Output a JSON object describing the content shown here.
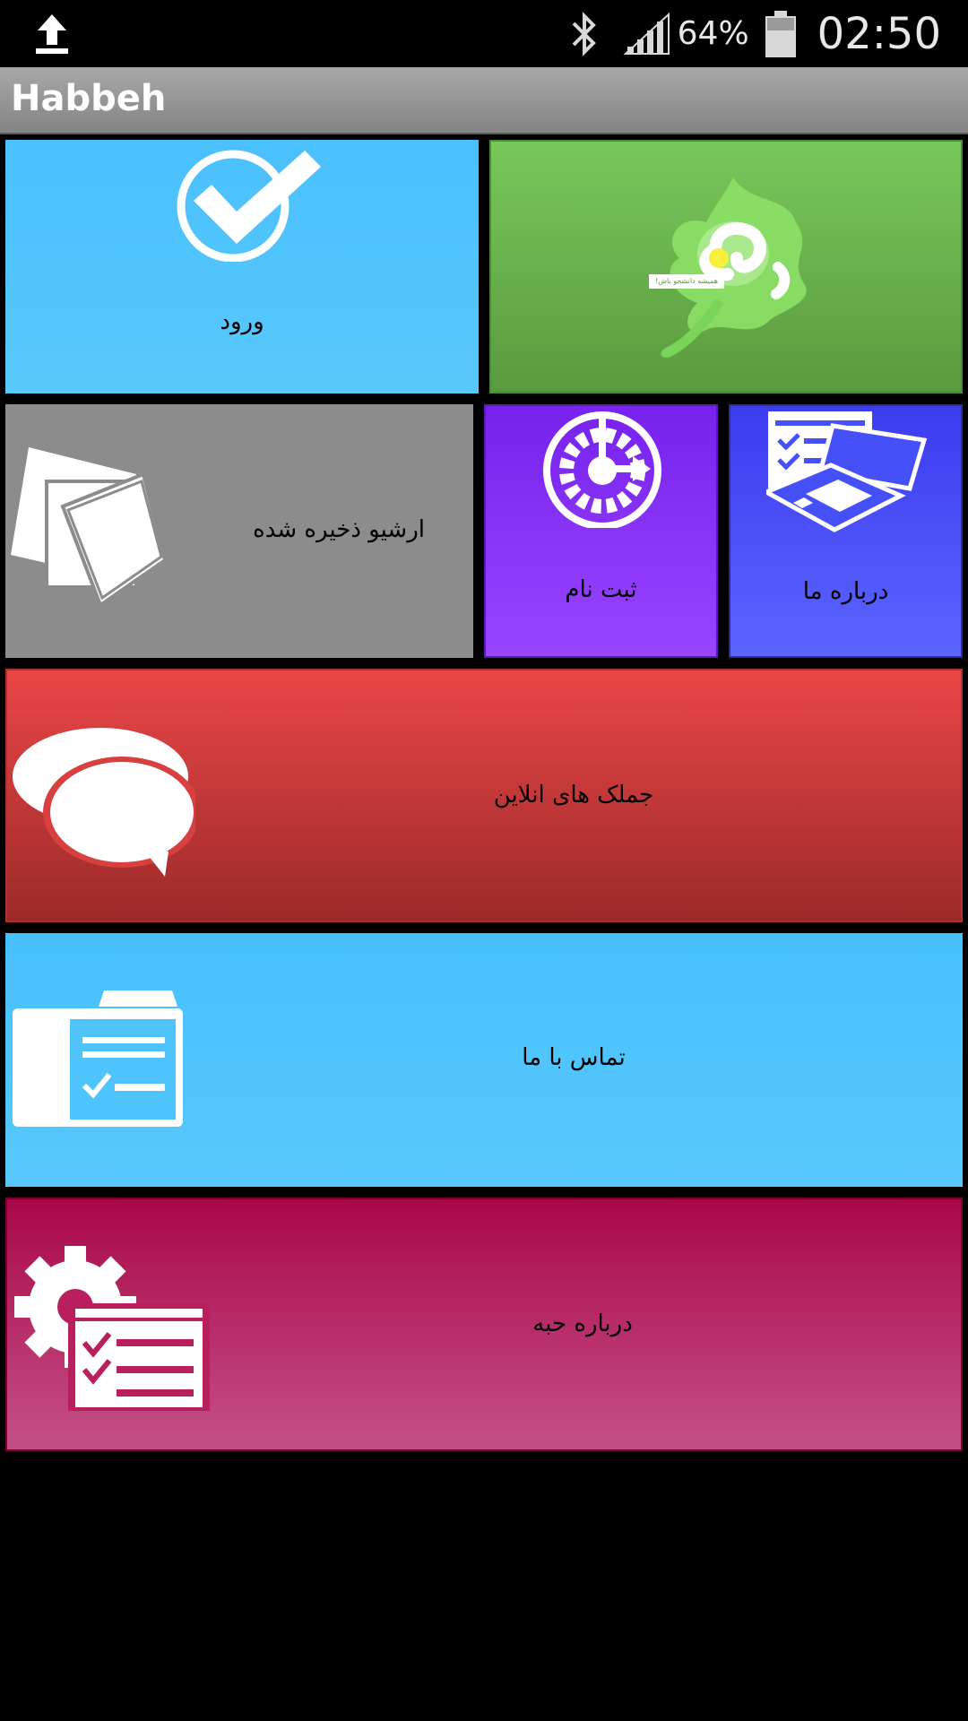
{
  "status_bar": {
    "battery_percent": "64%",
    "time": "02:50",
    "icons": [
      "upload-icon",
      "bluetooth-icon",
      "signal-icon",
      "battery-icon"
    ]
  },
  "app_bar": {
    "title": "Habbeh"
  },
  "tiles": {
    "login": {
      "label": "ورود",
      "icon": "checkmark-icon",
      "color": "#4fc3f7"
    },
    "logo": {
      "logo_text": "همیشه دانشجو باش!",
      "color": "#6cb84e"
    },
    "archive": {
      "label": "ارشیو ذخیره شده",
      "icon": "papers-icon",
      "color": "#8c8c8c"
    },
    "register": {
      "label": "ثبت نام",
      "icon": "clock-arrow-icon",
      "color": "#8833ff"
    },
    "about_us": {
      "label": "درباره ما",
      "icon": "devices-icon",
      "color": "#4650f8"
    },
    "online_jokes": {
      "label": "جملک های انلاین",
      "icon": "chat-bubbles-icon",
      "color": "#d03c3c"
    },
    "contact": {
      "label": "تماس با ما",
      "icon": "form-folder-icon",
      "color": "#4fc3fb"
    },
    "about_habbeh": {
      "label": "درباره حبه",
      "icon": "settings-list-icon",
      "color": "#b81f5c"
    }
  }
}
